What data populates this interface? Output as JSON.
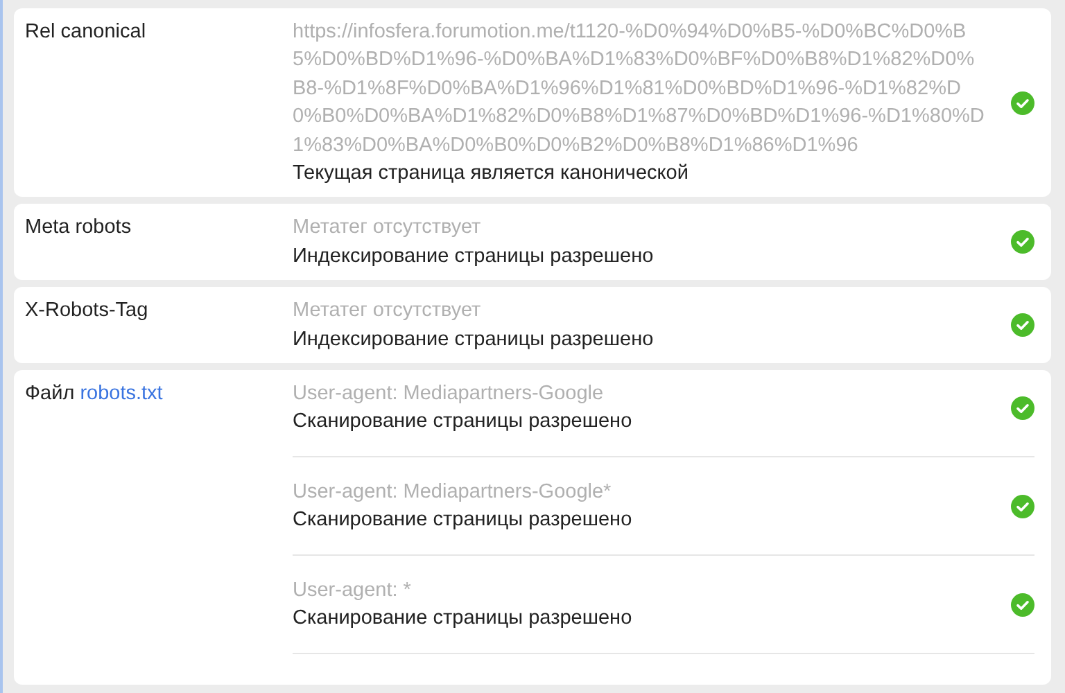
{
  "rows": [
    {
      "label": "Rel canonical",
      "entries": [
        {
          "value": "https://infosfera.forumotion.me/t1120-%D0%94%D0%B5-%D0%BC%D0%B5%D0%BD%D1%96-%D0%BA%D1%83%D0%BF%D0%B8%D1%82%D0%B8-%D1%8F%D0%BA%D1%96%D1%81%D0%BD%D1%96-%D1%82%D0%B0%D0%BA%D1%82%D0%B8%D1%87%D0%BD%D1%96-%D1%80%D1%83%D0%BA%D0%B0%D0%B2%D0%B8%D1%86%D1%96",
          "verdict": "Текущая страница является канонической",
          "passed": true
        }
      ]
    },
    {
      "label": "Meta robots",
      "entries": [
        {
          "value": "Метатег отсутствует",
          "verdict": "Индексирование страницы разрешено",
          "passed": true
        }
      ]
    },
    {
      "label": "X-Robots-Tag",
      "entries": [
        {
          "value": "Метатег отсутствует",
          "verdict": "Индексирование страницы разрешено",
          "passed": true
        }
      ]
    },
    {
      "label": "Файл",
      "label_link": "robots.txt",
      "entries": [
        {
          "value": "User-agent: Mediapartners-Google",
          "verdict": "Сканирование страницы разрешено",
          "passed": true
        },
        {
          "value": "User-agent: Mediapartners-Google*",
          "verdict": "Сканирование страницы разрешено",
          "passed": true
        },
        {
          "value": "User-agent: *",
          "verdict": "Сканирование страницы разрешено",
          "passed": true
        }
      ]
    }
  ]
}
